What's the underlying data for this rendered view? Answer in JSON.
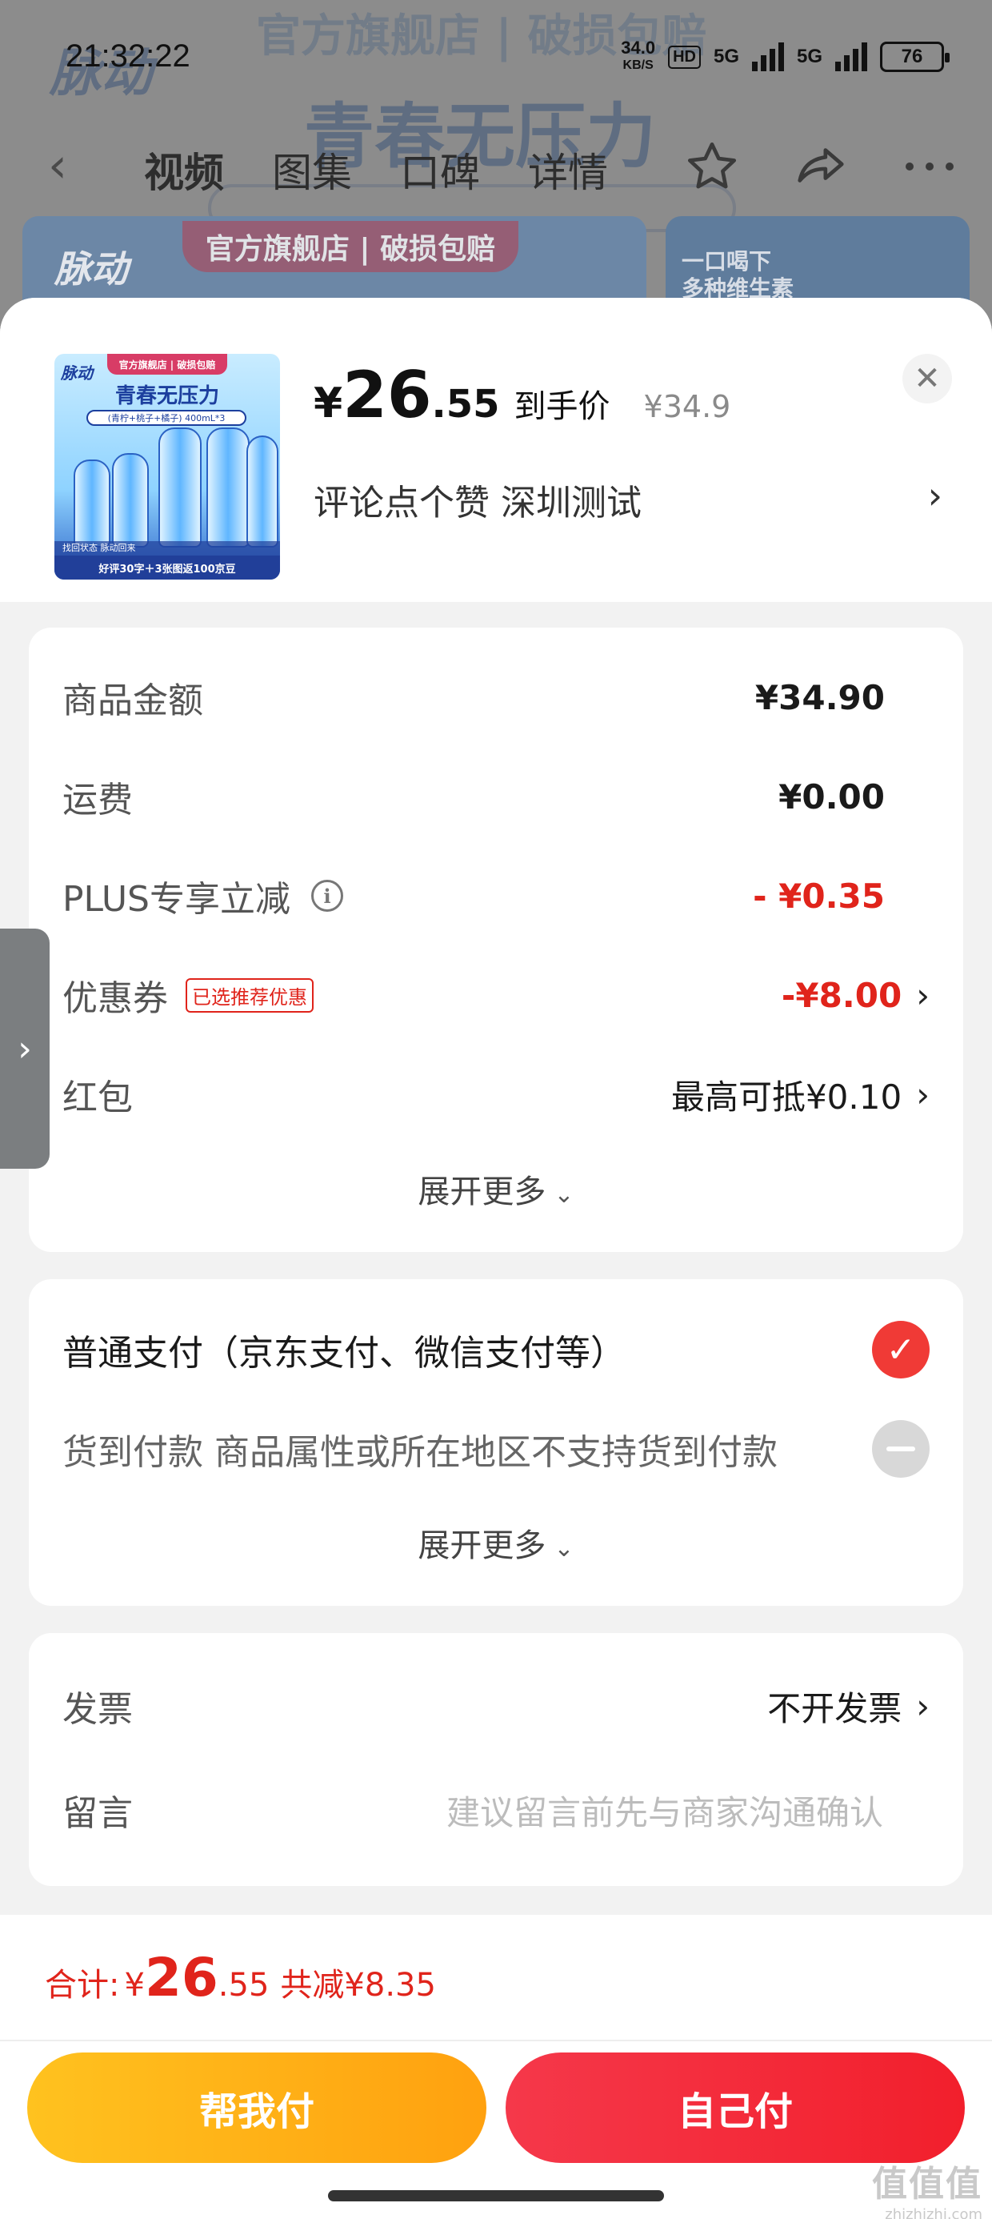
{
  "status_bar": {
    "time": "21:32:22",
    "speed_value": "34.0",
    "speed_unit": "KB/S",
    "hd": "HD",
    "net1": "5G",
    "net2": "5G",
    "battery": "76"
  },
  "background": {
    "banner_top": "官方旗舰店 | 破损包赔",
    "logo": "脉动",
    "slogan": "青春无压力",
    "nav_tabs": [
      "视频",
      "图集",
      "口碑",
      "详情"
    ],
    "card_ribbon": "官方旗舰店 | 破损包赔",
    "card_logo": "脉动",
    "right_card_text": "一口喝下\n多种维生素"
  },
  "product": {
    "image": {
      "ribbon": "官方旗舰店 | 破损包赔",
      "logo": "脉动",
      "slogan": "青春无压力",
      "spec": "(青柠+桃子+橘子) 400mL*3",
      "tagline": "找回状态 脉动回来",
      "promo": "好评30字＋3张图返100京豆"
    },
    "price_yen": "¥",
    "price_int": "26",
    "price_dec": ".55",
    "price_tag": "到手价",
    "price_original": "¥34.9",
    "spec_text": "评论点个赞  深圳测试"
  },
  "fees": {
    "goods_label": "商品金额",
    "goods_value": "¥34.90",
    "shipping_label": "运费",
    "shipping_value": "¥0.00",
    "plus_label": "PLUS专享立减",
    "plus_value": "- ¥0.35",
    "coupon_label": "优惠券",
    "coupon_tag": "已选推荐优惠",
    "coupon_value": "-¥8.00",
    "redpack_label": "红包",
    "redpack_value": "最高可抵¥0.10",
    "expand": "展开更多"
  },
  "payment": {
    "normal": "普通支付（京东支付、微信支付等）",
    "cod": "货到付款 商品属性或所在地区不支持货到付款",
    "expand": "展开更多"
  },
  "extras": {
    "invoice_label": "发票",
    "invoice_value": "不开发票",
    "message_label": "留言",
    "message_placeholder": "建议留言前先与商家沟通确认"
  },
  "footer": {
    "total_label": "合计:",
    "total_yen": "¥",
    "total_int": "26",
    "total_dec": ".55",
    "total_save": "共减¥8.35",
    "help_pay": "帮我付",
    "self_pay": "自己付"
  },
  "watermark": {
    "main": "值值值",
    "sub": "zhizhizhi.com"
  },
  "colors": {
    "accent_red": "#e0241b",
    "help_btn": "#ffb11a",
    "self_btn": "#f3283a"
  }
}
